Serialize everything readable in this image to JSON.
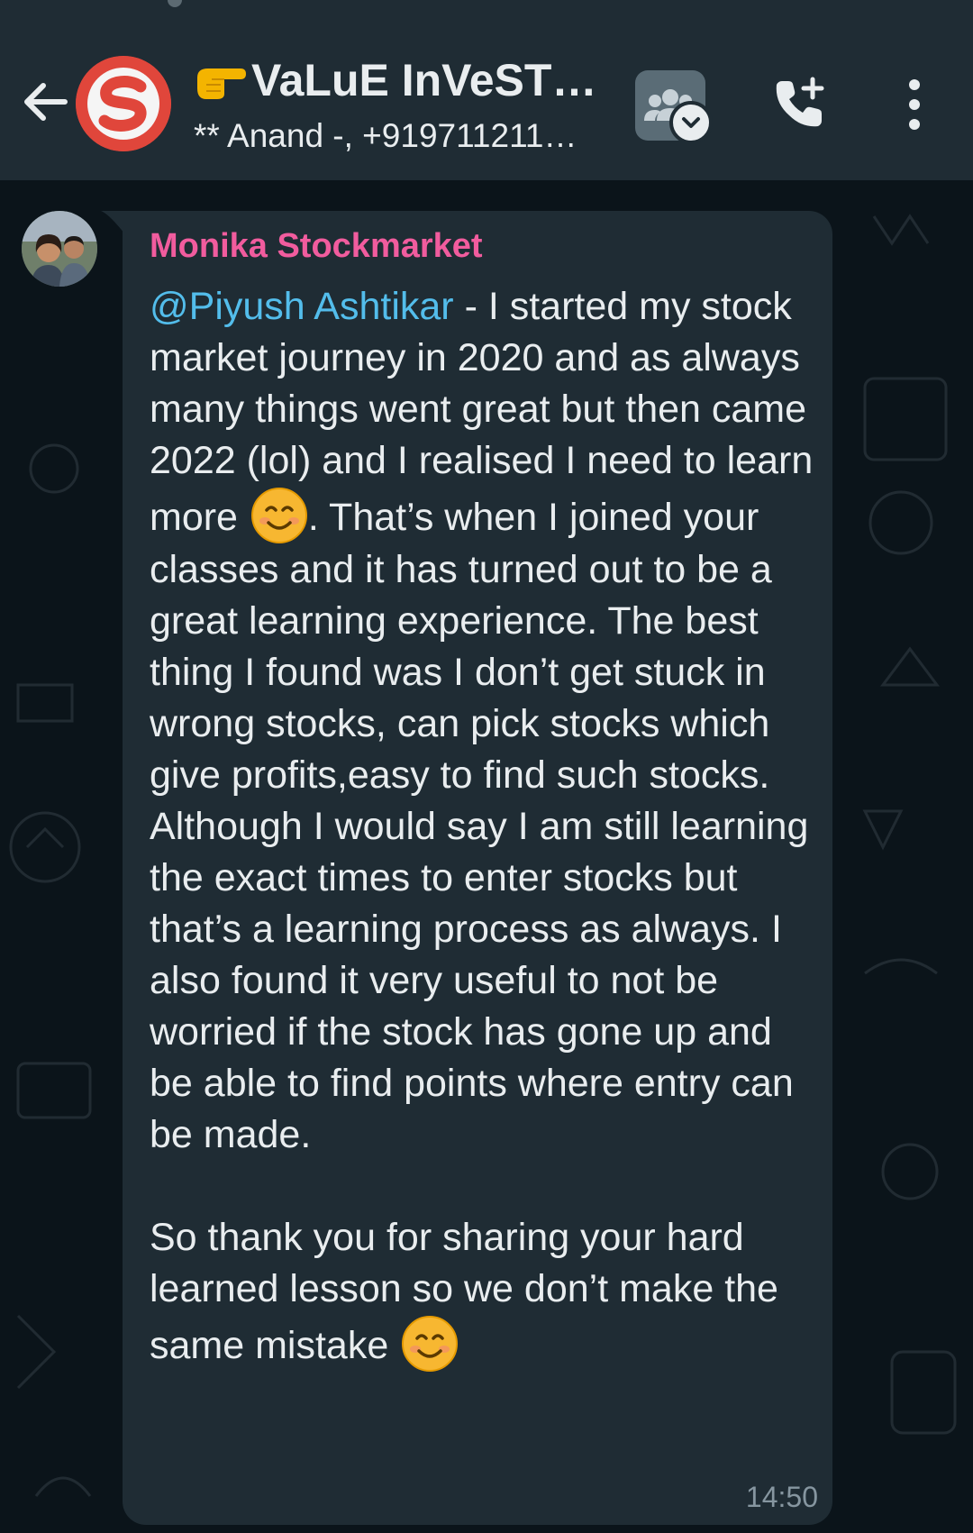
{
  "header": {
    "title": "VaLuE InVeST…",
    "subtitle": "** Anand -, +919711211…"
  },
  "message": {
    "sender": "Monika Stockmarket",
    "mention": "@Piyush Ashtikar",
    "line1_rest": " - I started my stock market journey in 2020 and as always many things went great but then came 2022 (lol) and I realised I need to learn more",
    "after_emoji": ".",
    "paragraph_rest": "That’s when I joined your classes and it has turned out to be a great learning experience. The best thing I found was I don’t get stuck in wrong stocks, can pick stocks which give profits,easy to find such stocks. Although I would say I am still learning the exact times to enter stocks but that’s a learning process as always. I also found it very useful to not be worried if the stock has gone up and be able to find points where entry can be made.",
    "paragraph2": "So thank you for sharing your hard learned lesson so we don’t make the same mistake",
    "time": "14:50"
  },
  "icons": {
    "back": "arrow-left-icon",
    "group_avatar": "group-logo-icon",
    "pointing": "backhand-index-pointing-right-emoji",
    "community": "community-icon",
    "add_call": "add-call-icon",
    "menu": "more-vertical-icon",
    "smile": "smiling-face-emoji"
  },
  "colors": {
    "header_bg": "#1f2c34",
    "chat_bg": "#0b141a",
    "bubble_bg": "#1f2c34",
    "sender_name": "#f15c9e",
    "mention": "#53bdeb",
    "text": "#e9edef",
    "time": "#8696a0"
  }
}
